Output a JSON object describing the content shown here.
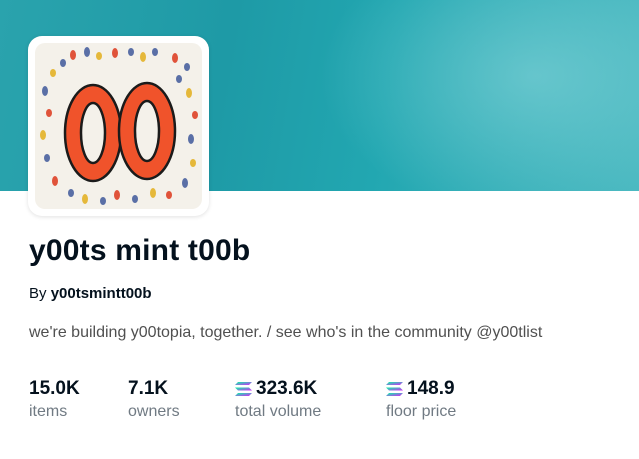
{
  "collection": {
    "title": "y00ts mint t00b",
    "by_label": "By",
    "creator": "y00tsmintt00b",
    "description": "we're building y00topia, together. / see who's in the community @y00tlist",
    "avatar_text": "00"
  },
  "stats": [
    {
      "value": "15.0K",
      "label": "items",
      "icon": null
    },
    {
      "value": "7.1K",
      "label": "owners",
      "icon": null
    },
    {
      "value": "323.6K",
      "label": "total volume",
      "icon": "solana-icon"
    },
    {
      "value": "148.9",
      "label": "floor price",
      "icon": "solana-icon"
    }
  ],
  "colors": {
    "banner": "#1e9aa6",
    "avatar_digits": "#f0532b",
    "text_primary": "#04111d",
    "text_secondary": "#707a83"
  }
}
